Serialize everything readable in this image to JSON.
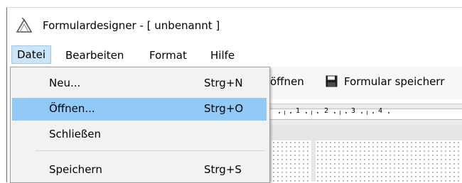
{
  "window": {
    "title": "Formulardesigner - [ unbenannt ]",
    "app_icon": "triangle-logo-icon"
  },
  "menubar": {
    "items": [
      "Datei",
      "Bearbeiten",
      "Format",
      "Hilfe"
    ],
    "open": "Datei"
  },
  "toolbar": {
    "open_label": "öffnen",
    "save_label": "Formular speicherr",
    "save_icon": "floppy-disk-icon"
  },
  "ruler": {
    "labels": [
      "1",
      "2",
      "3",
      "4"
    ]
  },
  "file_menu": {
    "items": [
      {
        "label": "Neu...",
        "shortcut": "Strg+N"
      },
      {
        "label": "Öffnen...",
        "shortcut": "Strg+O",
        "highlighted": true
      },
      {
        "label": "Schließen",
        "shortcut": ""
      },
      {
        "label": "Speichern",
        "shortcut": "Strg+S"
      }
    ]
  },
  "colors": {
    "highlight": "#91c9f7",
    "menu_bg": "#f2f2f2",
    "active_menu": "#cce4f7"
  }
}
